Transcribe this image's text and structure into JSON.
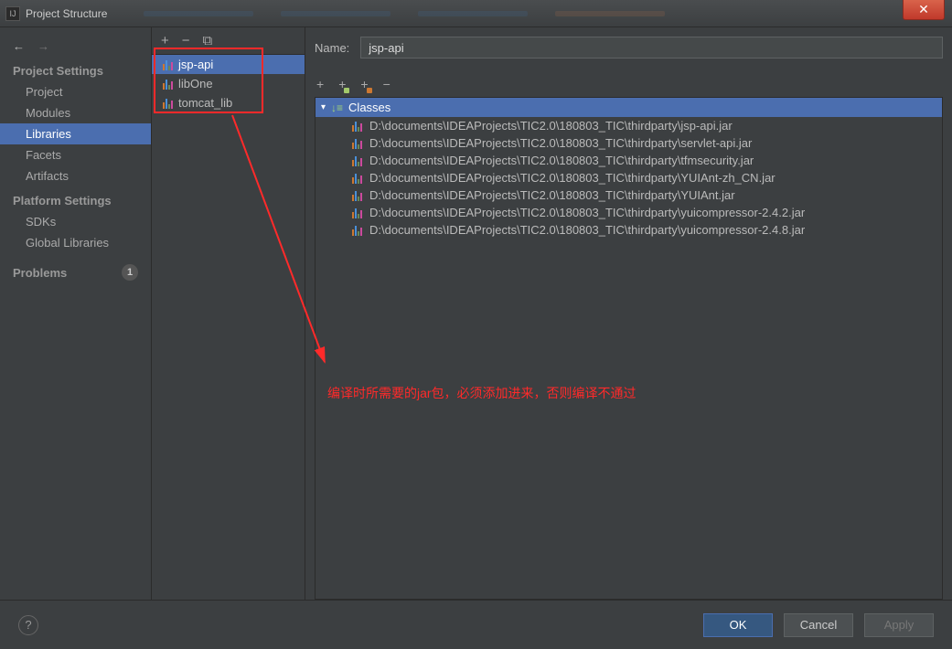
{
  "window": {
    "title": "Project Structure"
  },
  "sidebar": {
    "sections": [
      {
        "title": "Project Settings",
        "items": [
          "Project",
          "Modules",
          "Libraries",
          "Facets",
          "Artifacts"
        ],
        "selectedIndex": 2
      },
      {
        "title": "Platform Settings",
        "items": [
          "SDKs",
          "Global Libraries"
        ]
      }
    ],
    "problems_label": "Problems",
    "problems_count": "1"
  },
  "libraries": {
    "items": [
      "jsp-api",
      "libOne",
      "tomcat_lib"
    ],
    "selectedIndex": 0
  },
  "detail": {
    "name_label": "Name:",
    "name_value": "jsp-api",
    "tree_header": "Classes",
    "jars": [
      "D:\\documents\\IDEAProjects\\TIC2.0\\180803_TIC\\thirdparty\\jsp-api.jar",
      "D:\\documents\\IDEAProjects\\TIC2.0\\180803_TIC\\thirdparty\\servlet-api.jar",
      "D:\\documents\\IDEAProjects\\TIC2.0\\180803_TIC\\thirdparty\\tfmsecurity.jar",
      "D:\\documents\\IDEAProjects\\TIC2.0\\180803_TIC\\thirdparty\\YUIAnt-zh_CN.jar",
      "D:\\documents\\IDEAProjects\\TIC2.0\\180803_TIC\\thirdparty\\YUIAnt.jar",
      "D:\\documents\\IDEAProjects\\TIC2.0\\180803_TIC\\thirdparty\\yuicompressor-2.4.2.jar",
      "D:\\documents\\IDEAProjects\\TIC2.0\\180803_TIC\\thirdparty\\yuicompressor-2.4.8.jar"
    ]
  },
  "annotation": {
    "text": "编译时所需要的jar包，必须添加进来，否则编译不通过"
  },
  "footer": {
    "ok": "OK",
    "cancel": "Cancel",
    "apply": "Apply"
  }
}
